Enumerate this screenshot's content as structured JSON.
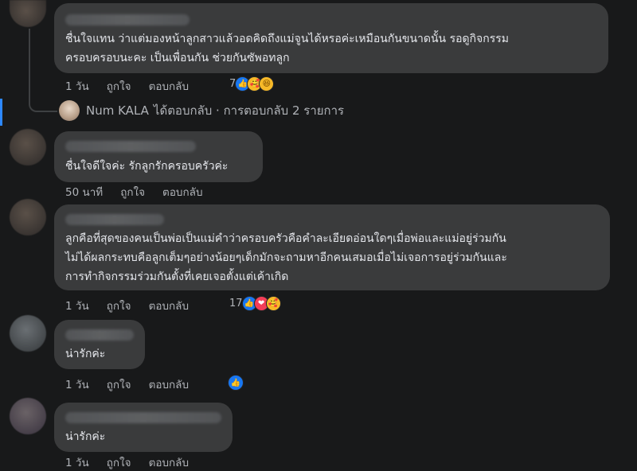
{
  "comments": [
    {
      "text_lines": [
        "ชื่นใจแทน ว่าแต่มองหน้าลูกสาวแล้วอดคิดถึงแม่จูนได้หรอค่ะเหมือนกันขนาดนั้น รอดูกิจกรรม",
        "ครอบครอบนะคะ เป็นเพื่อนกัน ช่วยกันซัพอทลูก"
      ],
      "time": "1 วัน",
      "like": "ถูกใจ",
      "reply": "ตอบกลับ",
      "reaction_count": "7",
      "reactions": [
        "like-icon",
        "care-icon",
        "haha-icon"
      ]
    },
    {
      "text_lines": [
        "ชื่นใจดีใจค่ะ รักลูกรักครอบครัวค่ะ"
      ],
      "time": "50 นาที",
      "like": "ถูกใจ",
      "reply": "ตอบกลับ"
    },
    {
      "text_lines": [
        "ลูกคือที่สุดของคนเป็นพ่อเป็นแม่คำว่าครอบครัวคือคำละเอียดอ่อนใดๆเมื่อพ่อและแม่อยู่ร่วมกัน",
        "ไม่ได้ผลกระทบคือลูกเต็มๆอย่างน้อยๆเด็กมักจะถามหาอีกคนเสมอเมื่อไม่เจอการอยู่ร่วมกันและ",
        "การทำกิจกรรมร่วมกันตั้งที่เคยเจอตั้งแต่เค้าเกิด"
      ],
      "time": "1 วัน",
      "like": "ถูกใจ",
      "reply": "ตอบกลับ",
      "reaction_count": "17",
      "reactions": [
        "like-icon",
        "love-icon",
        "care-icon"
      ]
    },
    {
      "text_lines": [
        "น่ารักค่ะ"
      ],
      "time": "1 วัน",
      "like": "ถูกใจ",
      "reply": "ตอบกลับ",
      "reactions": [
        "like-icon"
      ]
    },
    {
      "text_lines": [
        "น่ารักค่ะ"
      ],
      "time": "1 วัน",
      "like": "ถูกใจ",
      "reply": "ตอบกลับ"
    }
  ],
  "reply_summary": {
    "author": "Num KALA",
    "text": "ได้ตอบกลับ · การตอบกลับ 2 รายการ"
  },
  "colors": {
    "background": "#18191a",
    "bubble": "#3a3b3c",
    "secondary_text": "#b0b3b8",
    "like_blue": "#1877f2"
  }
}
